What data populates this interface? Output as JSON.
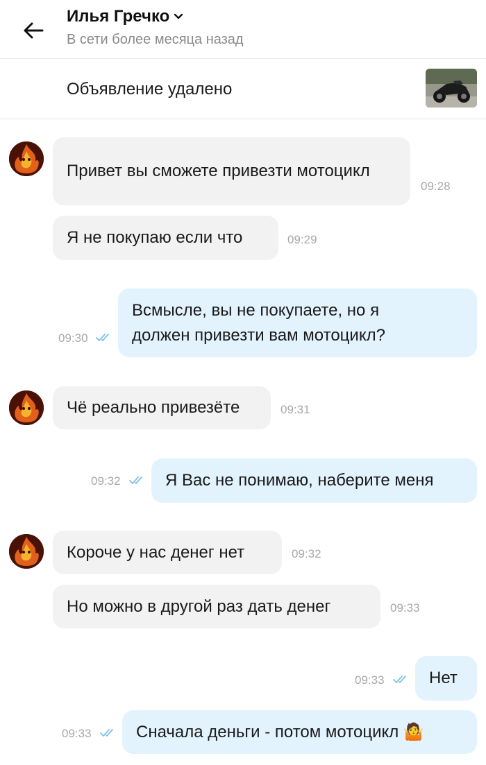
{
  "header": {
    "contact_name": "Илья Гречко",
    "status": "В сети более месяца назад"
  },
  "listing": {
    "status_text": "Объявление удалено",
    "thumbnail": "motorcycle-photo"
  },
  "messages": [
    {
      "direction": "incoming",
      "text": "Привет вы сможете привезти мотоцикл",
      "time": "09:28"
    },
    {
      "direction": "incoming",
      "text": "Я не покупаю если что",
      "time": "09:29"
    },
    {
      "direction": "outgoing",
      "text": "Всмысле, вы не покупаете, но я должен привезти вам мотоцикл?",
      "time": "09:30",
      "read": true
    },
    {
      "direction": "incoming",
      "text": "Чё реально привезёте",
      "time": "09:31"
    },
    {
      "direction": "outgoing",
      "text": "Я Вас не понимаю, наберите меня",
      "time": "09:32",
      "read": true
    },
    {
      "direction": "incoming",
      "text": "Короче у нас денег нет",
      "time": "09:32"
    },
    {
      "direction": "incoming",
      "text": "Но можно в другой раз дать денег",
      "time": "09:33"
    },
    {
      "direction": "outgoing",
      "text": "Нет",
      "time": "09:33",
      "read": true
    },
    {
      "direction": "outgoing",
      "text": "Сначала деньги - потом мотоцикл 🤷",
      "time": "09:33",
      "read": true
    }
  ],
  "colors": {
    "incoming_bubble": "#f2f2f2",
    "outgoing_bubble": "#e3f3fd",
    "read_ticks": "#7cc2ea",
    "timestamp": "#a8a8a8"
  }
}
